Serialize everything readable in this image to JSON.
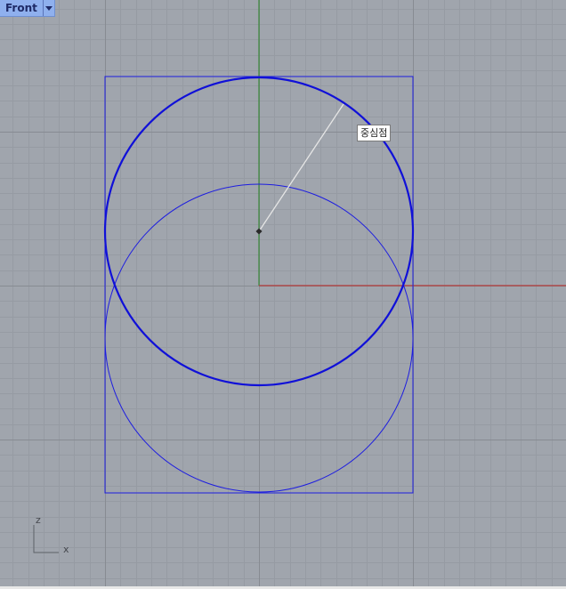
{
  "viewport": {
    "name": "Front",
    "background_color": "#a0a5ad",
    "minor_grid_color": "#969ba3",
    "major_grid_color": "#878b92"
  },
  "axes": {
    "x_axis_color": "#b33a3a",
    "y_axis_color": "#3a8a3a",
    "icon_label_z": "z",
    "icon_label_x": "x"
  },
  "geometry": {
    "color": "#1d1de0",
    "highlight_color": "#1010d8"
  },
  "snap": {
    "tooltip": "중심점",
    "line_color": "#e6e6e6"
  },
  "icons": {
    "dropdown": "chevron-down-icon",
    "center_marker": "center-point-icon"
  }
}
